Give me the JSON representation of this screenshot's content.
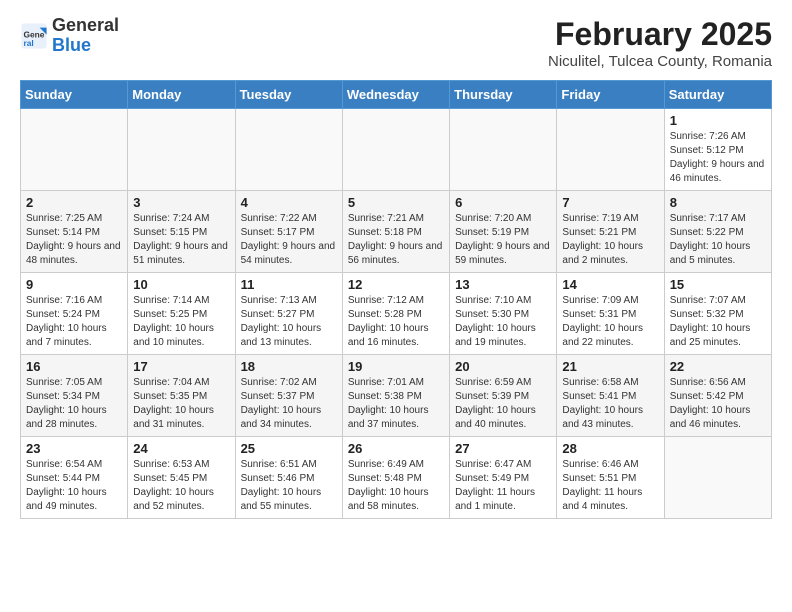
{
  "header": {
    "logo_general": "General",
    "logo_blue": "Blue",
    "month_year": "February 2025",
    "location": "Niculitel, Tulcea County, Romania"
  },
  "weekdays": [
    "Sunday",
    "Monday",
    "Tuesday",
    "Wednesday",
    "Thursday",
    "Friday",
    "Saturday"
  ],
  "weeks": [
    [
      {
        "day": "",
        "info": ""
      },
      {
        "day": "",
        "info": ""
      },
      {
        "day": "",
        "info": ""
      },
      {
        "day": "",
        "info": ""
      },
      {
        "day": "",
        "info": ""
      },
      {
        "day": "",
        "info": ""
      },
      {
        "day": "1",
        "info": "Sunrise: 7:26 AM\nSunset: 5:12 PM\nDaylight: 9 hours and 46 minutes."
      }
    ],
    [
      {
        "day": "2",
        "info": "Sunrise: 7:25 AM\nSunset: 5:14 PM\nDaylight: 9 hours and 48 minutes."
      },
      {
        "day": "3",
        "info": "Sunrise: 7:24 AM\nSunset: 5:15 PM\nDaylight: 9 hours and 51 minutes."
      },
      {
        "day": "4",
        "info": "Sunrise: 7:22 AM\nSunset: 5:17 PM\nDaylight: 9 hours and 54 minutes."
      },
      {
        "day": "5",
        "info": "Sunrise: 7:21 AM\nSunset: 5:18 PM\nDaylight: 9 hours and 56 minutes."
      },
      {
        "day": "6",
        "info": "Sunrise: 7:20 AM\nSunset: 5:19 PM\nDaylight: 9 hours and 59 minutes."
      },
      {
        "day": "7",
        "info": "Sunrise: 7:19 AM\nSunset: 5:21 PM\nDaylight: 10 hours and 2 minutes."
      },
      {
        "day": "8",
        "info": "Sunrise: 7:17 AM\nSunset: 5:22 PM\nDaylight: 10 hours and 5 minutes."
      }
    ],
    [
      {
        "day": "9",
        "info": "Sunrise: 7:16 AM\nSunset: 5:24 PM\nDaylight: 10 hours and 7 minutes."
      },
      {
        "day": "10",
        "info": "Sunrise: 7:14 AM\nSunset: 5:25 PM\nDaylight: 10 hours and 10 minutes."
      },
      {
        "day": "11",
        "info": "Sunrise: 7:13 AM\nSunset: 5:27 PM\nDaylight: 10 hours and 13 minutes."
      },
      {
        "day": "12",
        "info": "Sunrise: 7:12 AM\nSunset: 5:28 PM\nDaylight: 10 hours and 16 minutes."
      },
      {
        "day": "13",
        "info": "Sunrise: 7:10 AM\nSunset: 5:30 PM\nDaylight: 10 hours and 19 minutes."
      },
      {
        "day": "14",
        "info": "Sunrise: 7:09 AM\nSunset: 5:31 PM\nDaylight: 10 hours and 22 minutes."
      },
      {
        "day": "15",
        "info": "Sunrise: 7:07 AM\nSunset: 5:32 PM\nDaylight: 10 hours and 25 minutes."
      }
    ],
    [
      {
        "day": "16",
        "info": "Sunrise: 7:05 AM\nSunset: 5:34 PM\nDaylight: 10 hours and 28 minutes."
      },
      {
        "day": "17",
        "info": "Sunrise: 7:04 AM\nSunset: 5:35 PM\nDaylight: 10 hours and 31 minutes."
      },
      {
        "day": "18",
        "info": "Sunrise: 7:02 AM\nSunset: 5:37 PM\nDaylight: 10 hours and 34 minutes."
      },
      {
        "day": "19",
        "info": "Sunrise: 7:01 AM\nSunset: 5:38 PM\nDaylight: 10 hours and 37 minutes."
      },
      {
        "day": "20",
        "info": "Sunrise: 6:59 AM\nSunset: 5:39 PM\nDaylight: 10 hours and 40 minutes."
      },
      {
        "day": "21",
        "info": "Sunrise: 6:58 AM\nSunset: 5:41 PM\nDaylight: 10 hours and 43 minutes."
      },
      {
        "day": "22",
        "info": "Sunrise: 6:56 AM\nSunset: 5:42 PM\nDaylight: 10 hours and 46 minutes."
      }
    ],
    [
      {
        "day": "23",
        "info": "Sunrise: 6:54 AM\nSunset: 5:44 PM\nDaylight: 10 hours and 49 minutes."
      },
      {
        "day": "24",
        "info": "Sunrise: 6:53 AM\nSunset: 5:45 PM\nDaylight: 10 hours and 52 minutes."
      },
      {
        "day": "25",
        "info": "Sunrise: 6:51 AM\nSunset: 5:46 PM\nDaylight: 10 hours and 55 minutes."
      },
      {
        "day": "26",
        "info": "Sunrise: 6:49 AM\nSunset: 5:48 PM\nDaylight: 10 hours and 58 minutes."
      },
      {
        "day": "27",
        "info": "Sunrise: 6:47 AM\nSunset: 5:49 PM\nDaylight: 11 hours and 1 minute."
      },
      {
        "day": "28",
        "info": "Sunrise: 6:46 AM\nSunset: 5:51 PM\nDaylight: 11 hours and 4 minutes."
      },
      {
        "day": "",
        "info": ""
      }
    ]
  ]
}
